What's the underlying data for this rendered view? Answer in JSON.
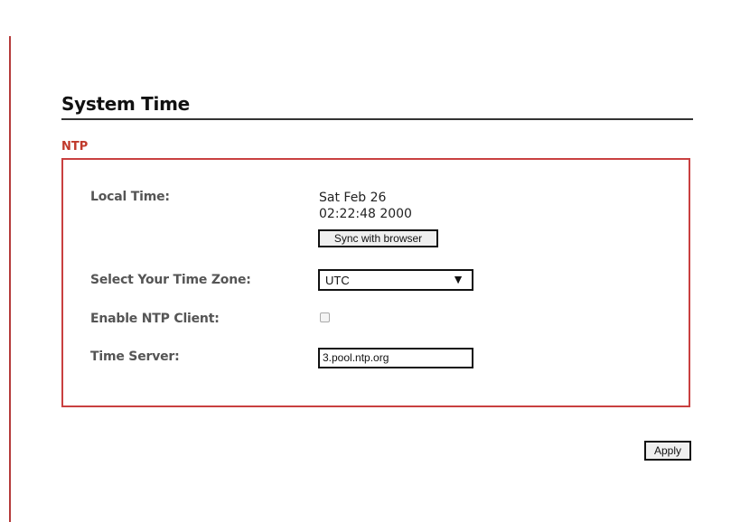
{
  "page": {
    "title": "System Time",
    "section": "NTP"
  },
  "local_time": {
    "label": "Local Time:",
    "line1": "Sat Feb 26",
    "line2": "02:22:48 2000",
    "sync_button": "Sync with browser"
  },
  "time_zone": {
    "label": "Select Your Time Zone:",
    "selected": "UTC",
    "arrow_icon": "triangle-down-icon"
  },
  "ntp_client": {
    "label": "Enable NTP Client:",
    "checked": false
  },
  "time_server": {
    "label": "Time Server:",
    "value": "3.pool.ntp.org"
  },
  "actions": {
    "apply": "Apply"
  },
  "colors": {
    "accent": "#c94040",
    "section_label": "#c0392b",
    "left_rule": "#b53a3a"
  }
}
